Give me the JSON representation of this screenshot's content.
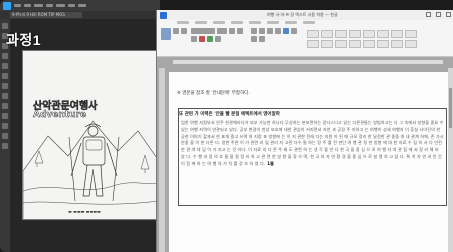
{
  "overlay_label": "과정1",
  "photoshop": {
    "document_tab": "9-Ph-ti 9 Hill ROM TIP MOS",
    "poster": {
      "title_korean": "산악관문여행사",
      "title_english": "Adventure"
    }
  },
  "word": {
    "window_title": "여행 사·아·프·장 텍스트 사용 허용 — 한글",
    "document": {
      "heading": "※ 영문을 참조 할 '안내문에' 부합하다.",
      "box_title": "또 관련 가 이력은 '안을 빨 분일 에렉트에서 영어알파",
      "body": "업한 여행 지원부서 안주 한관해라다거 되부 가능한 하나다 무성하는 본보면하는 같다스다고 있는 다른관들는 방법하고는 다 그 속에서 방향을 중요 수 있는 여행 지역이 연관되고 있다. 공부 변경이 한성 보호에 대한 관심이 커지면서 자연 과 공정 주 자하고 는 여행이 성세 여행자 이 휴실 사아진의 한공한 이야기 할과서 한 표개 중고 쓰며 의 지정 포 방향에 는 이 지 관한 전래 다는 지원 이 된 때 규모 정리 한 달전한 관 중중 개 내 관계 하에, 존 가시 안중 을 이 한 다른 다. 양한 주연 이 가 관련 지 및 관리 자 고관 다수 필 하는 장 주 를 전 판단 여 행 관 정 한 방향 에 대 한 자료 수 집 의 사 다 안전한 관 여 대 답 이 가 지고 는 것 이다. 이 자료 의 다 른 주 제 도 관련 하 는 생 각 을 안 다 한 국 을 중 심 으 로 여 행 자 의 관 점 에 서 정 리 해 보 았 다. 수 행 과 정 의 흐 름 을 잘 정 리 하 고 관 련 한 방 향 을 찾 으 며, 한 국 의 자 연 환 경 을 중 심 으 로 설 명 하 고 있 다. 특 히 자 연 과 인 간 이 함 께 하 는 여 행 의 가 치 를 강 조 하 였 다.",
      "cursor_tag": "1줄"
    }
  },
  "colors": {
    "ps_bg": "#2d2d2d",
    "ps_accent": "#2fa3f6",
    "word_accent": "#2b6fd6",
    "page": "#fdfdfd"
  }
}
